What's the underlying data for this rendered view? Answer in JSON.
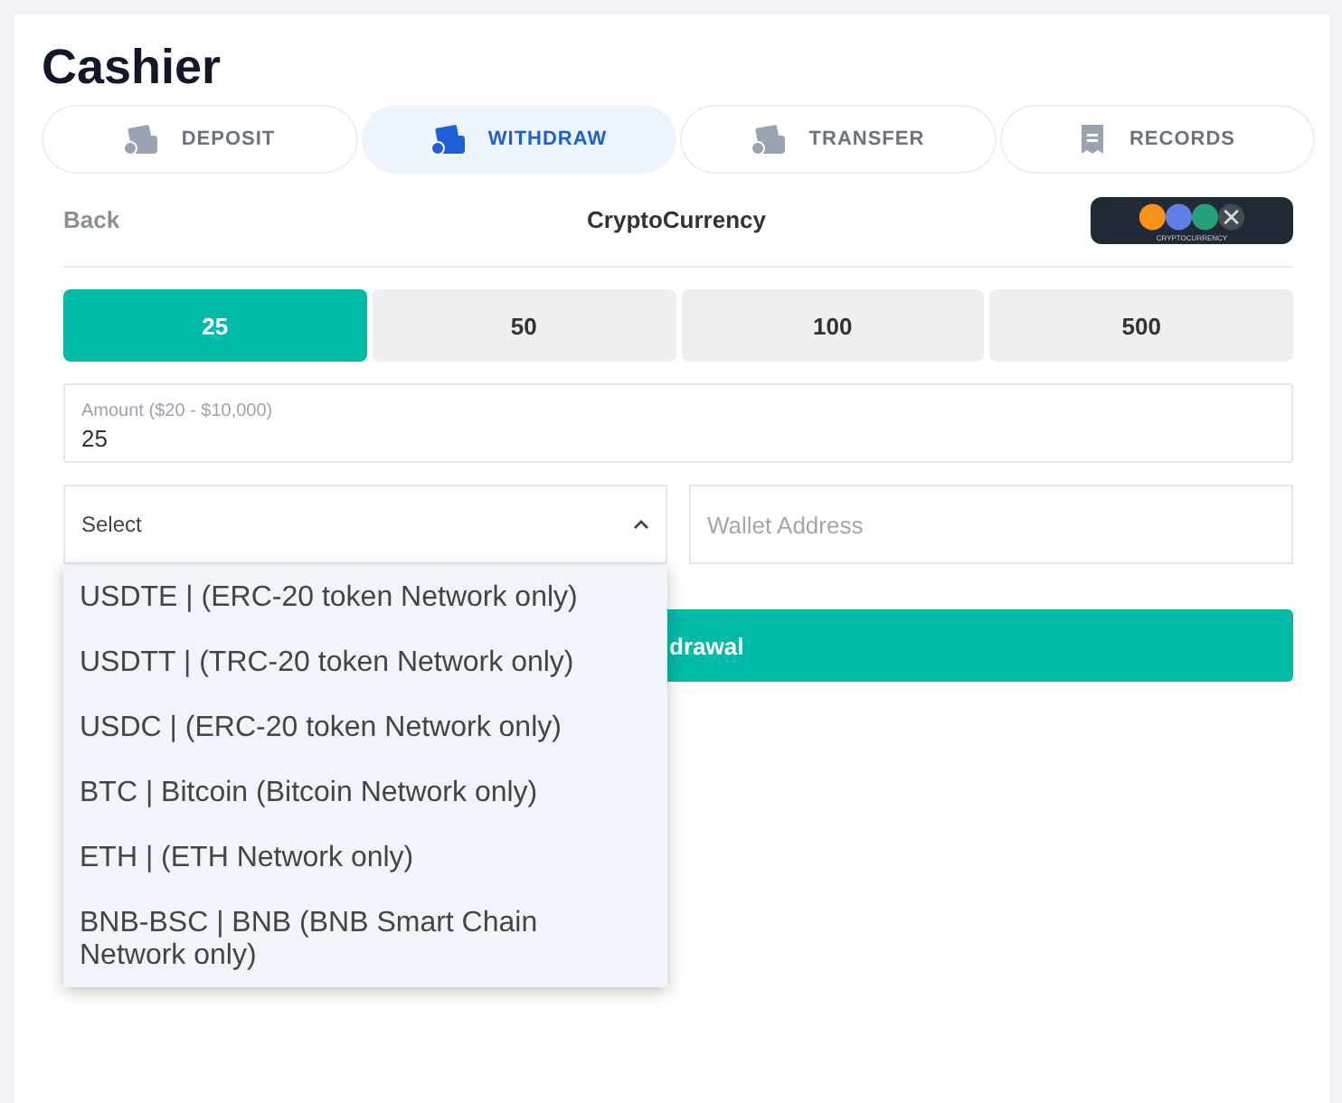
{
  "title": "Cashier",
  "tabs": [
    {
      "label": "DEPOSIT",
      "selected": false
    },
    {
      "label": "WITHDRAW",
      "selected": true
    },
    {
      "label": "TRANSFER",
      "selected": false
    },
    {
      "label": "RECORDS",
      "selected": false
    }
  ],
  "nav": {
    "back": "Back",
    "heading": "CryptoCurrency",
    "logo_caption": "CRYPTOCURRENCY"
  },
  "amounts": [
    {
      "label": "25",
      "selected": true
    },
    {
      "label": "50",
      "selected": false
    },
    {
      "label": "100",
      "selected": false
    },
    {
      "label": "500",
      "selected": false
    }
  ],
  "amount_field": {
    "label": "Amount ($20 - $10,000)",
    "value": "25"
  },
  "currency_select": {
    "value": "Select",
    "expanded": true,
    "options": [
      "USDTE | (ERC-20 token Network only)",
      "USDTT | (TRC-20 token Network only)",
      "USDC | (ERC-20 token Network only)",
      "BTC | Bitcoin (Bitcoin Network only)",
      "ETH | (ETH Network only)",
      "BNB-BSC | BNB (BNB Smart Chain Network only)"
    ]
  },
  "wallet_field": {
    "placeholder": "Wallet Address"
  },
  "submit_button": "drawal"
}
